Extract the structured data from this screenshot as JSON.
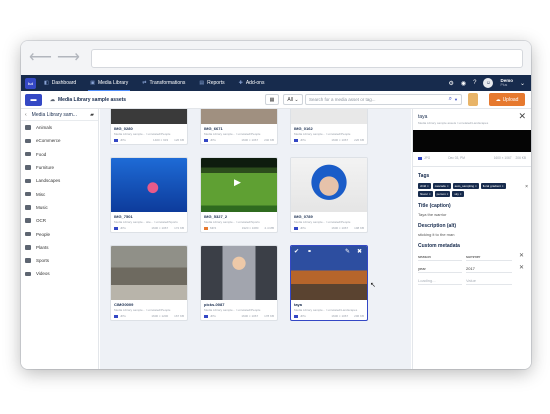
{
  "nav": {
    "logo": "lui",
    "items": [
      {
        "label": "Dashboard",
        "icon": "dashboard-icon"
      },
      {
        "label": "Media Library",
        "icon": "media-icon"
      },
      {
        "label": "Transformations",
        "icon": "transform-icon"
      },
      {
        "label": "Reports",
        "icon": "reports-icon"
      },
      {
        "label": "Add-ons",
        "icon": "addons-icon"
      }
    ],
    "account_name": "Demo",
    "account_sub": "Plus"
  },
  "toolbar": {
    "breadcrumb": "Media Library sample assets",
    "filter": "All",
    "search_placeholder": "Search for a media asset or tag...",
    "upload_label": "Upload"
  },
  "sidebar": {
    "header": "Media Library sam...",
    "folders": [
      "Animals",
      "eCommerce",
      "Food",
      "Furniture",
      "Landscapes",
      "Misc",
      "Music",
      "OCR",
      "People",
      "Plants",
      "Sports",
      "Videos"
    ]
  },
  "assets": [
    {
      "name": "IMG_0280",
      "sub": "Media Library sample... / unrelated/People",
      "type": "JPG",
      "dims": "1400 × 933",
      "size": "126 KB"
    },
    {
      "name": "IMG_6671",
      "sub": "Media Library sample... / unrelated/People",
      "type": "JPG",
      "dims": "1600 × 1067",
      "size": "240 KB"
    },
    {
      "name": "IMG_0162",
      "sub": "Media Library sample... / unrelated/People",
      "type": "JPG",
      "dims": "1600 × 1067",
      "size": "226 KB"
    },
    {
      "name": "IMG_7501",
      "sub": "Media Library sample... site... / unrelated/Sports",
      "type": "JPG",
      "dims": "1600 × 1067",
      "size": "172 KB"
    },
    {
      "name": "IMG_5327_2",
      "sub": "Media Library sample... / unrelated/Sports",
      "type": "MP4",
      "dims": "1920 × 1080",
      "size": "2.4 MB"
    },
    {
      "name": "IMG_0789",
      "sub": "Media Library sample... / unrelated/People",
      "type": "JPG",
      "dims": "1600 × 1067",
      "size": "198 KB"
    },
    {
      "name": "CIMG0009",
      "sub": "Media Library sample... / unrelated/People",
      "type": "JPG",
      "dims": "1600 × 1200",
      "size": "167 KB"
    },
    {
      "name": "picks-0087",
      "sub": "Media Library sample... / unrelated/People",
      "type": "JPG",
      "dims": "1600 × 1067",
      "size": "178 KB"
    },
    {
      "name": "taya",
      "sub": "Media Library sample... / unrelated/Landscapes",
      "type": "JPG",
      "dims": "1600 × 1067",
      "size": "206 KB"
    }
  ],
  "details": {
    "title": "taya",
    "sub": "Media Library sample assets / unrelated/Landscapes",
    "type": "JPG",
    "date": "Dec 03, PM",
    "dims": "1600 × 1067",
    "size": "206 KB",
    "tags_label": "Tags",
    "tags": [
      "child",
      "cascade",
      "auto_sampling",
      "floral gradient",
      "flower",
      "person",
      "sky"
    ],
    "title_label": "Title (caption)",
    "title_value": "Taya the warrior",
    "desc_label": "Description (alt)",
    "desc_value": "sticking it to the man",
    "custom_label": "Custom metadata",
    "metadata": [
      {
        "key": "season",
        "value": "summer"
      },
      {
        "key": "year",
        "value": "2017"
      },
      {
        "key": "Loading...",
        "value": "Value"
      }
    ]
  },
  "colors": {
    "nav": "#172b4d",
    "accent": "#3448c5",
    "upload": "#e6792f"
  }
}
